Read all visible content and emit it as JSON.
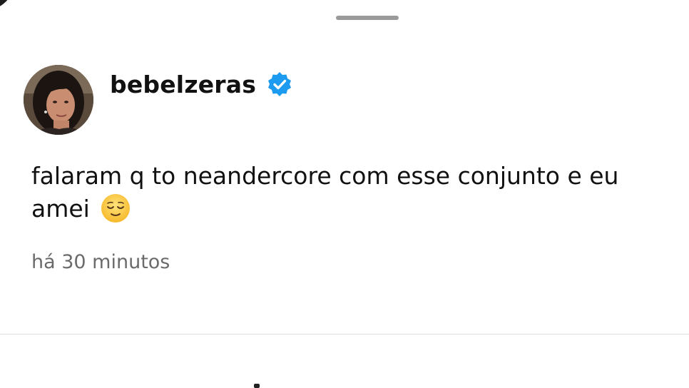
{
  "sheet": {
    "drag_handle": "drag-handle"
  },
  "post": {
    "author": {
      "username": "bebelzeras",
      "verified": true,
      "verified_icon": "verified-badge-icon",
      "verified_color": "#1d9bf0"
    },
    "text": "falaram q to neandercore com esse conjunto e eu amei",
    "emoji": "😌",
    "timestamp": "há 30 minutos"
  },
  "colors": {
    "text": "#111111",
    "timestamp": "#6b6b6b",
    "divider": "#dddddd",
    "background": "#ffffff"
  }
}
